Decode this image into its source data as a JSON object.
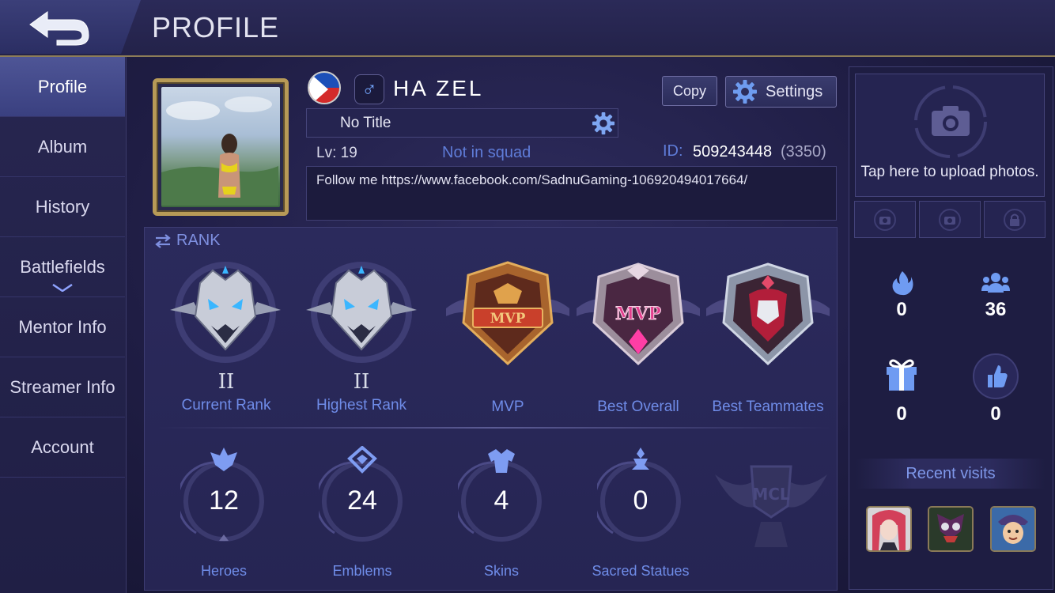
{
  "header": {
    "title": "PROFILE"
  },
  "sidebar": {
    "items": [
      {
        "label": "Profile",
        "active": true
      },
      {
        "label": "Album"
      },
      {
        "label": "History"
      },
      {
        "label": "Battlefields"
      },
      {
        "label": "Mentor Info"
      },
      {
        "label": "Streamer Info"
      },
      {
        "label": "Account"
      }
    ]
  },
  "profile": {
    "name": "HA ZEL",
    "gender_symbol": "♂",
    "title": "No Title",
    "level": "Lv: 19",
    "squad": "Not in squad",
    "id_label": "ID:",
    "id": "509243448",
    "server": "(3350)",
    "bio": "Follow me https://www.facebook.com/SadnuGaming-106920494017664/",
    "copy_label": "Copy",
    "settings_label": "Settings"
  },
  "rank": {
    "header": "RANK",
    "badges": [
      {
        "label": "Current Rank",
        "tier": "II"
      },
      {
        "label": "Highest Rank",
        "tier": "II"
      },
      {
        "label": "MVP"
      },
      {
        "label": "Best Overall"
      },
      {
        "label": "Best Teammates"
      }
    ],
    "stats": [
      {
        "label": "Heroes",
        "value": "12"
      },
      {
        "label": "Emblems",
        "value": "24"
      },
      {
        "label": "Skins",
        "value": "4"
      },
      {
        "label": "Sacred Statues",
        "value": "0"
      }
    ],
    "mcl_text": "MCL"
  },
  "right": {
    "upload_text": "Tap here to upload photos.",
    "popularity": "0",
    "followers": "36",
    "gifts": "0",
    "likes": "0",
    "recent_visits": "Recent visits"
  },
  "colors": {
    "accent_blue": "#6f8ce8",
    "gold_frame": "#b79a57",
    "bg": "#1f1d44"
  }
}
